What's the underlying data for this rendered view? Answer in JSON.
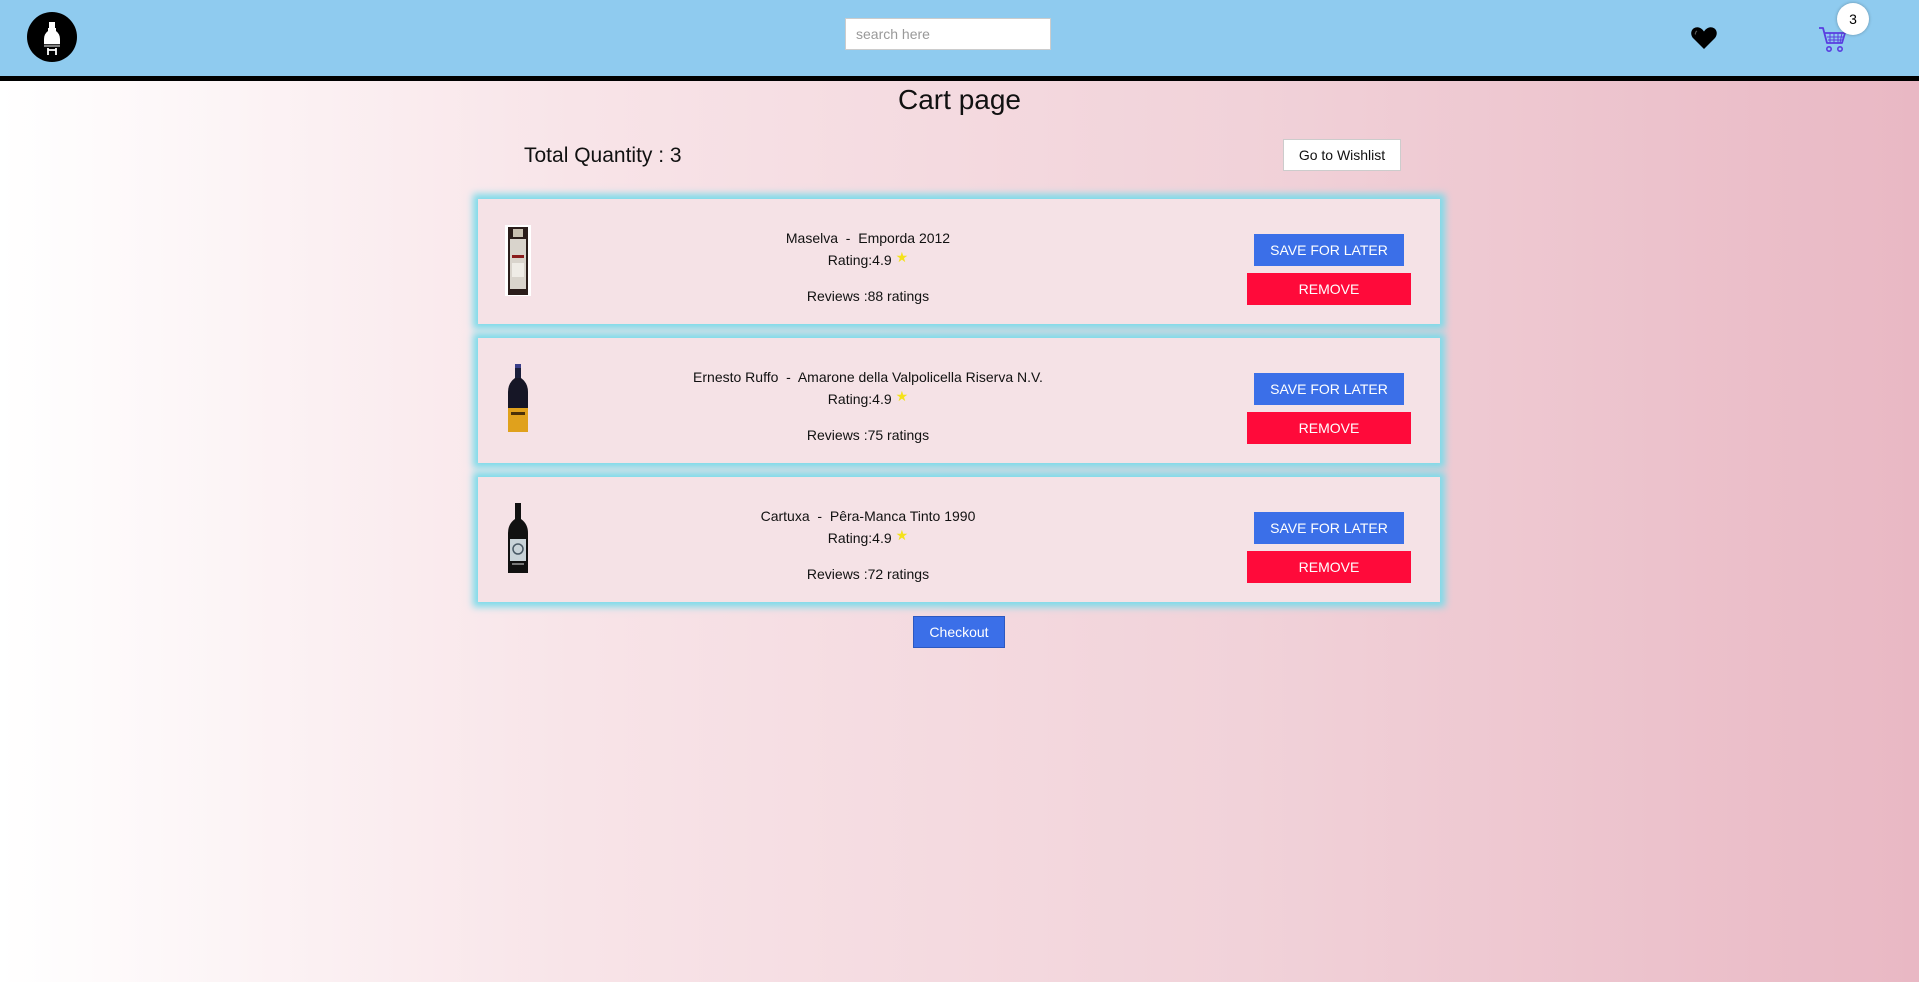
{
  "header": {
    "logo_icon": "wine-bottle-logo",
    "search_placeholder": "search here",
    "wishlist_icon": "heart-icon",
    "cart_icon": "shopping-cart-icon",
    "cart_count": "3",
    "navbar_color": "#8fcbef"
  },
  "page": {
    "title": "Cart page",
    "total_quantity": "Total Quantity : 3",
    "wishlist_button": "Go to Wishlist",
    "checkout_button": "Checkout"
  },
  "cart": {
    "items": [
      {
        "name": "Maselva  -  Emporda 2012",
        "rating": "Rating:4.9",
        "reviews": "Reviews :88 ratings",
        "save_label": "SAVE FOR LATER",
        "remove_label": "REMOVE"
      },
      {
        "name": "Ernesto Ruffo  -  Amarone della Valpolicella Riserva N.V.",
        "rating": "Rating:4.9",
        "reviews": "Reviews :75 ratings",
        "save_label": "SAVE FOR LATER",
        "remove_label": "REMOVE"
      },
      {
        "name": "Cartuxa  -  Pêra-Manca Tinto 1990",
        "rating": "Rating:4.9",
        "reviews": "Reviews :72 ratings",
        "save_label": "SAVE FOR LATER",
        "remove_label": "REMOVE"
      }
    ]
  },
  "colors": {
    "primary_button": "#3b6fe8",
    "remove_button": "#ff0a3a",
    "card_glow": "#7ddbea",
    "star": "#f4e21b"
  }
}
